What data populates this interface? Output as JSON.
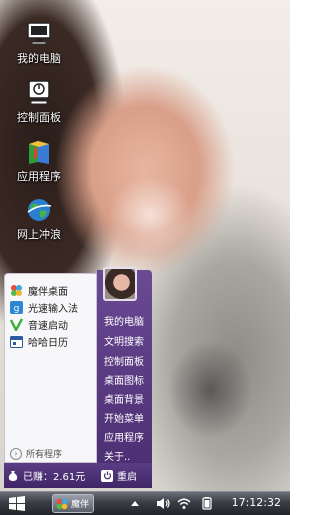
{
  "desktop_icons": [
    {
      "label": "我的电脑",
      "icon": "computer-icon"
    },
    {
      "label": "控制面板",
      "icon": "control-panel-icon"
    },
    {
      "label": "应用程序",
      "icon": "applications-icon"
    },
    {
      "label": "网上冲浪",
      "icon": "internet-globe-icon"
    }
  ],
  "start_menu": {
    "programs": [
      {
        "label": "魔伴桌面",
        "icon": "pinwheel-icon"
      },
      {
        "label": "光速输入法",
        "icon": "input-method-icon"
      },
      {
        "label": "音速启动",
        "icon": "quick-launch-icon"
      },
      {
        "label": "哈哈日历",
        "icon": "calendar-icon"
      }
    ],
    "all_programs": "所有程序",
    "right_items": [
      "我的电脑",
      "文明搜索",
      "控制面板",
      "桌面图标",
      "桌面背景",
      "开始菜单",
      "应用程序",
      "关于.."
    ],
    "earned": "已赚：2.61元",
    "restart": "重启"
  },
  "taskbar": {
    "app_label": "魔伴",
    "clock": "17:12:32"
  },
  "colors": {
    "menu_purple": "#4d2f74",
    "taskbar": "#2b2d33"
  }
}
